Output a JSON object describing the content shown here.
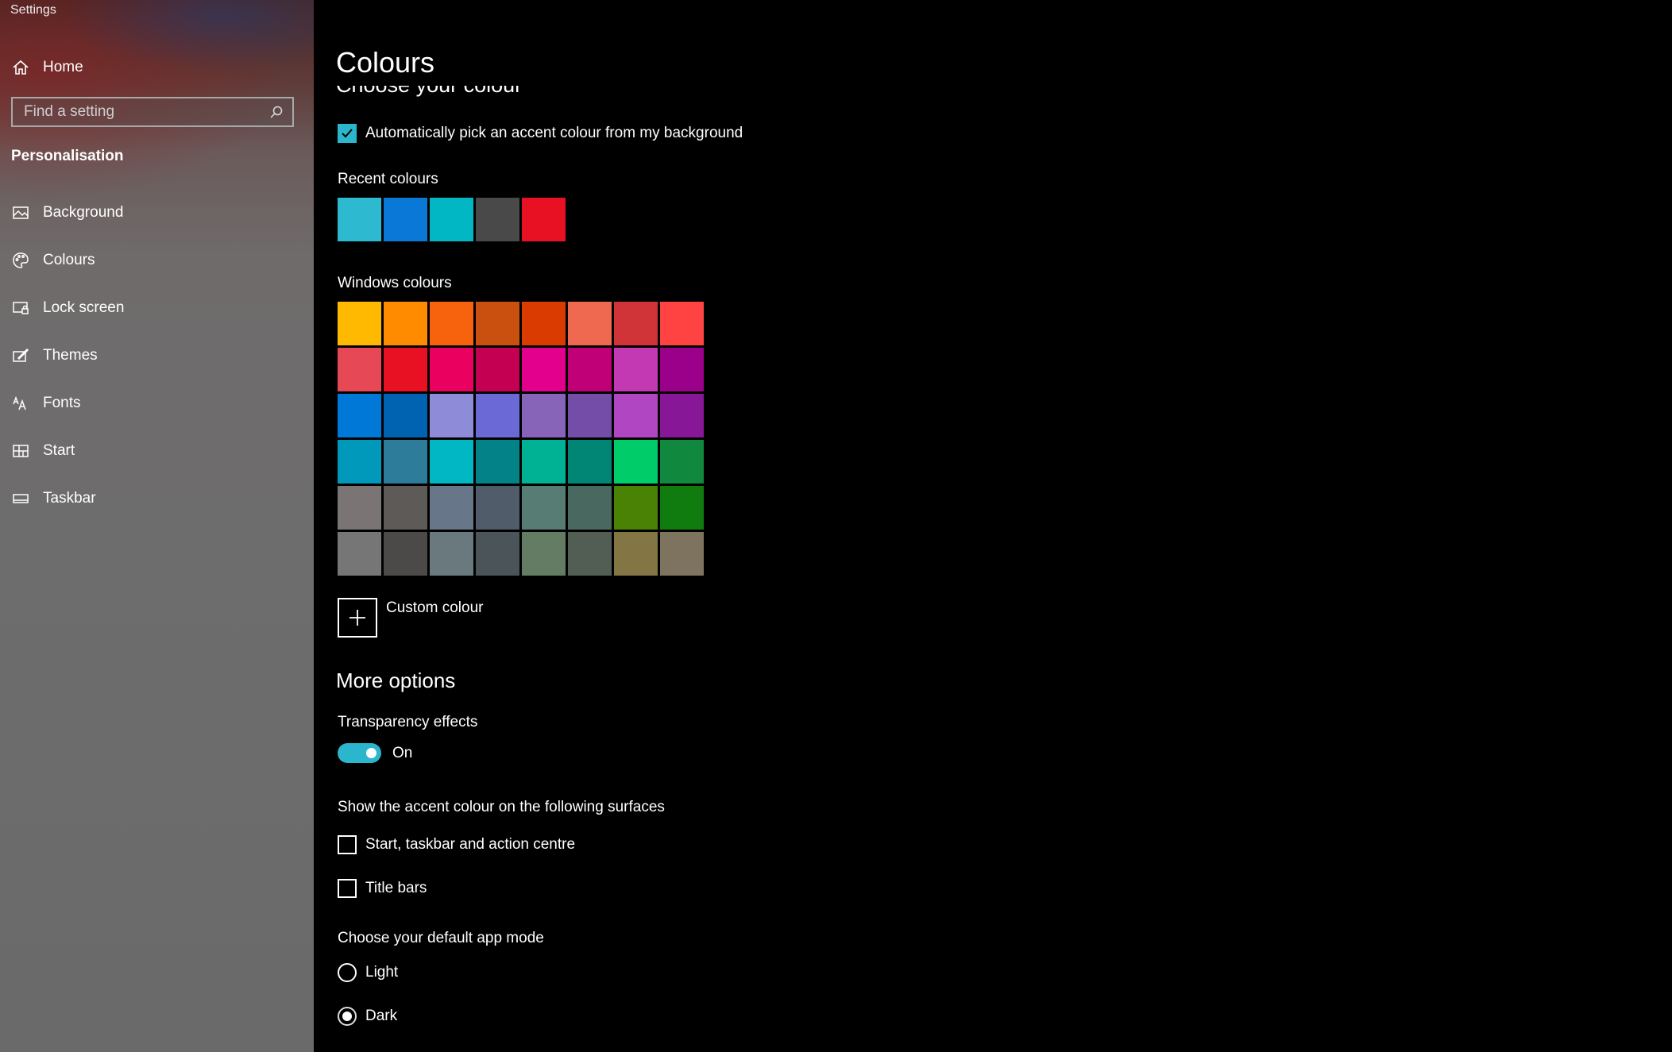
{
  "app": {
    "title": "Settings"
  },
  "sidebar": {
    "home_label": "Home",
    "search": {
      "placeholder": "Find a setting",
      "value": ""
    },
    "section": "Personalisation",
    "items": [
      {
        "label": "Background",
        "icon": "picture-icon"
      },
      {
        "label": "Colours",
        "icon": "palette-icon"
      },
      {
        "label": "Lock screen",
        "icon": "lock-screen-icon"
      },
      {
        "label": "Themes",
        "icon": "themes-icon"
      },
      {
        "label": "Fonts",
        "icon": "fonts-icon"
      },
      {
        "label": "Start",
        "icon": "start-icon"
      },
      {
        "label": "Taskbar",
        "icon": "taskbar-icon"
      }
    ]
  },
  "main": {
    "title": "Colours",
    "clipped_heading": "Choose your colour",
    "auto_accent": {
      "label": "Automatically pick an accent colour from my background",
      "checked": true
    },
    "recent": {
      "label": "Recent colours",
      "colors": [
        "#2dbad0",
        "#0a78d7",
        "#00b7c3",
        "#494949",
        "#e81123"
      ]
    },
    "windows": {
      "label": "Windows colours",
      "rows": [
        [
          "#ffb900",
          "#ff8c00",
          "#f7630c",
          "#ca5010",
          "#da3b01",
          "#ef6950",
          "#d13438",
          "#ff4343"
        ],
        [
          "#e74856",
          "#e81123",
          "#ea005e",
          "#c30052",
          "#e3008c",
          "#bf0077",
          "#c239b3",
          "#9a0089"
        ],
        [
          "#0078d7",
          "#0063b1",
          "#8e8cd8",
          "#6b69d6",
          "#8764b8",
          "#744da9",
          "#b146c2",
          "#881798"
        ],
        [
          "#0099bc",
          "#2d7d9a",
          "#00b7c3",
          "#038387",
          "#00b294",
          "#018574",
          "#00cc6a",
          "#10893e"
        ],
        [
          "#7a7574",
          "#5d5a58",
          "#68768a",
          "#515c6b",
          "#567c73",
          "#486860",
          "#498205",
          "#107c10"
        ],
        [
          "#767676",
          "#4c4a48",
          "#69797e",
          "#4a5459",
          "#647c64",
          "#525e54",
          "#847545",
          "#7e735f"
        ]
      ]
    },
    "custom_colour_label": "Custom colour",
    "more_options": "More options",
    "transparency": {
      "label": "Transparency effects",
      "state": "On"
    },
    "surfaces": {
      "label": "Show the accent colour on the following surfaces",
      "start_taskbar": {
        "label": "Start, taskbar and action centre",
        "checked": false
      },
      "title_bars": {
        "label": "Title bars",
        "checked": false
      }
    },
    "app_mode": {
      "label": "Choose your default app mode",
      "light": "Light",
      "dark": "Dark",
      "selected": "dark"
    }
  },
  "colors": {
    "accent": "#2ab6cc",
    "background": "#000000"
  }
}
